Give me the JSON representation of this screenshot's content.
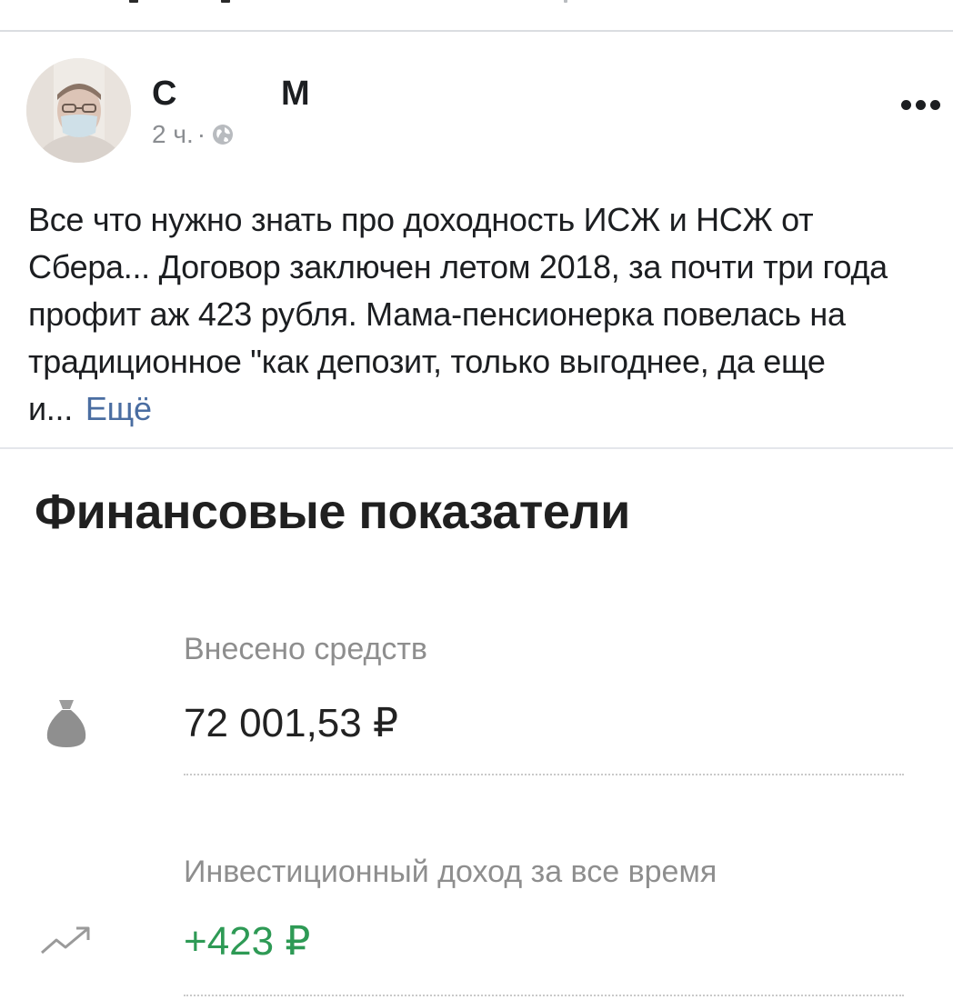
{
  "post": {
    "author_first": "С",
    "author_last": "М",
    "time": "2 ч.",
    "meta_separator": "·",
    "visibility_icon": "globe-icon",
    "more_icon": "more-horizontal-icon",
    "text": "Все что нужно знать про доходность ИСЖ и НСЖ от Сбера... Договор заключен летом 2018, за почти три года профит аж 423 рубля. Мама-пенсионерка повелась на традиционное \"как депозит, только выгоднее, да еще и...",
    "see_more": "Ещё"
  },
  "screenshot": {
    "title": "Финансовые показатели",
    "rows": [
      {
        "label": "Внесено средств",
        "value": "72 001,53 ₽",
        "icon": "money-bag-icon"
      },
      {
        "label": "Инвестиционный доход за все время",
        "value": "+423 ₽",
        "icon": "trend-up-icon"
      }
    ],
    "accent_color": "#2e9a55"
  }
}
